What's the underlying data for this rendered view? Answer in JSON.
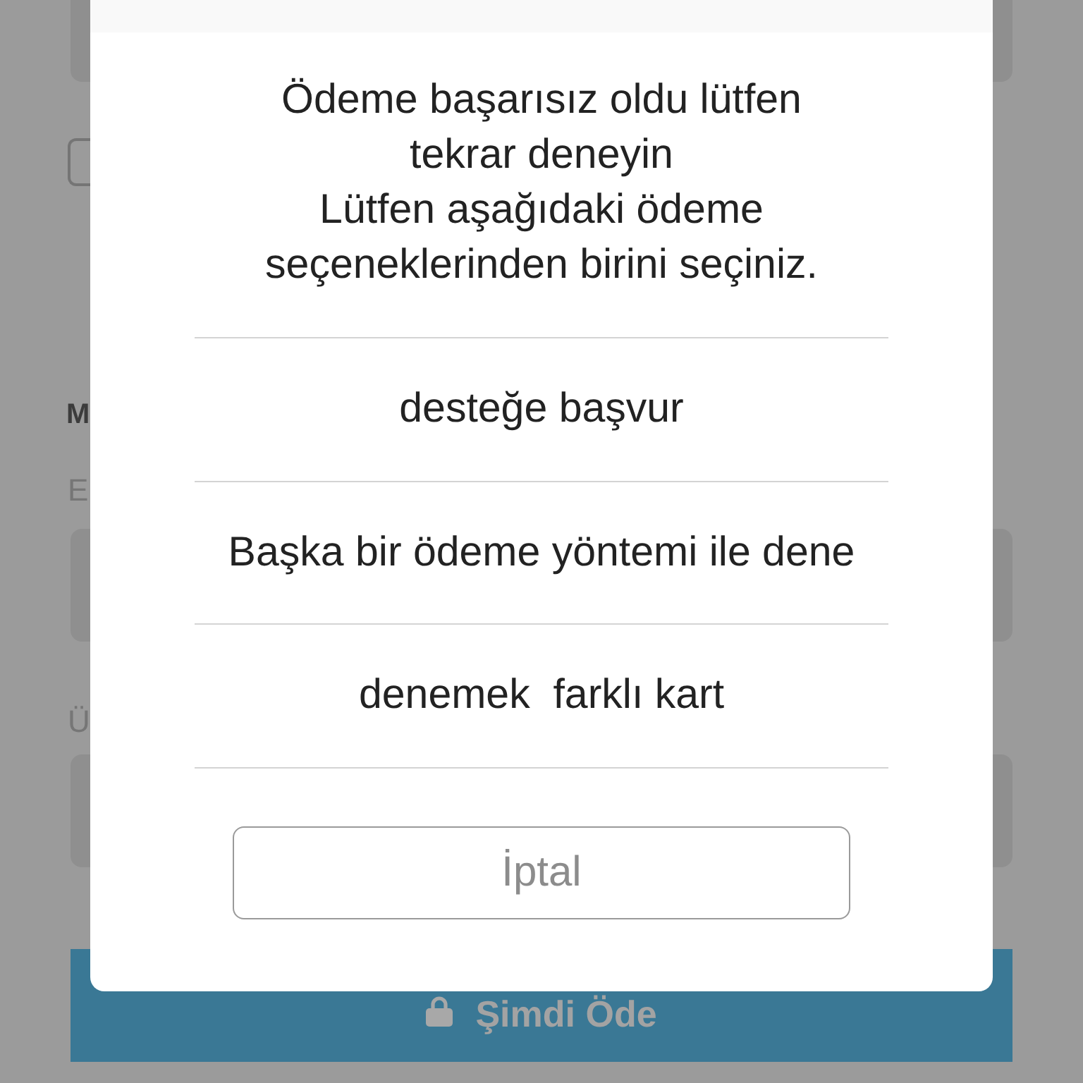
{
  "page": {
    "checkbox": {
      "checked": false
    },
    "heading": "M",
    "fields": [
      {
        "label": "E"
      },
      {
        "label": "Ü"
      }
    ],
    "pay_button": {
      "label": "Şimdi Öde"
    }
  },
  "dialog": {
    "message": [
      "Ödeme başarısız oldu lütfen tekrar deneyin",
      "Lütfen aşağıdaki ödeme seçeneklerinden birini seçiniz."
    ],
    "options": [
      "desteğe başvur",
      "Başka bir ödeme yöntemi ile dene",
      "denemek  farklı kart"
    ],
    "cancel_button": "İptal"
  }
}
